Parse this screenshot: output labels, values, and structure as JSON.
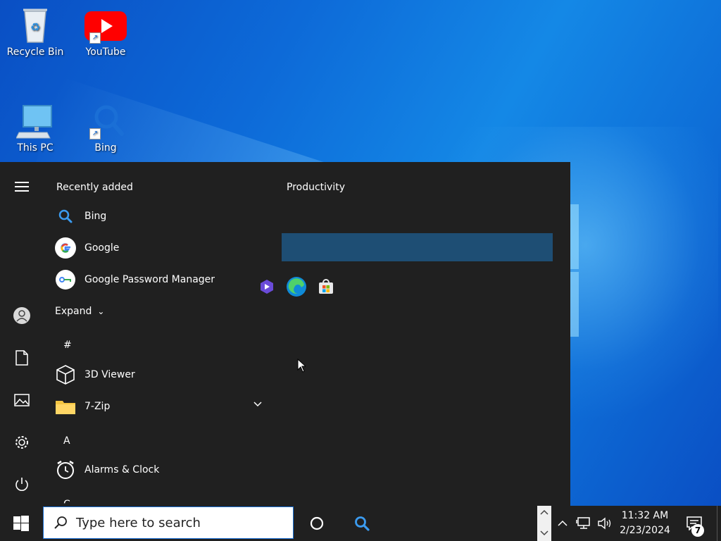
{
  "desktop": {
    "icons": [
      {
        "label": "Recycle Bin"
      },
      {
        "label": "YouTube"
      },
      {
        "label": "This PC"
      },
      {
        "label": "Bing"
      }
    ]
  },
  "start_menu": {
    "recently_added_title": "Recently added",
    "recent_apps": [
      {
        "label": "Bing",
        "icon": "bing-search-icon"
      },
      {
        "label": "Google",
        "icon": "google-icon"
      },
      {
        "label": "Google Password Manager",
        "icon": "password-manager-icon"
      }
    ],
    "expand_label": "Expand",
    "groups": [
      {
        "letter": "#",
        "apps": [
          {
            "label": "3D Viewer",
            "icon": "cube-icon"
          },
          {
            "label": "7-Zip",
            "icon": "folder-icon"
          }
        ]
      },
      {
        "letter": "A",
        "apps": [
          {
            "label": "Alarms & Clock",
            "icon": "alarm-clock-icon"
          }
        ]
      }
    ],
    "next_letter": "C",
    "tiles_group_title": "Productivity",
    "rail_icons": [
      "hamburger-menu-icon",
      "user-icon",
      "document-icon",
      "pictures-icon",
      "settings-icon",
      "power-icon"
    ]
  },
  "taskbar": {
    "search_placeholder": "Type here to search",
    "time": "11:32 AM",
    "date": "2/23/2024",
    "notification_count": "7"
  },
  "colors": {
    "menu_bg": "#202020",
    "taskbar_bg": "#202020",
    "tile_accent": "#1e4e74",
    "search_border": "#1a6fd6"
  }
}
